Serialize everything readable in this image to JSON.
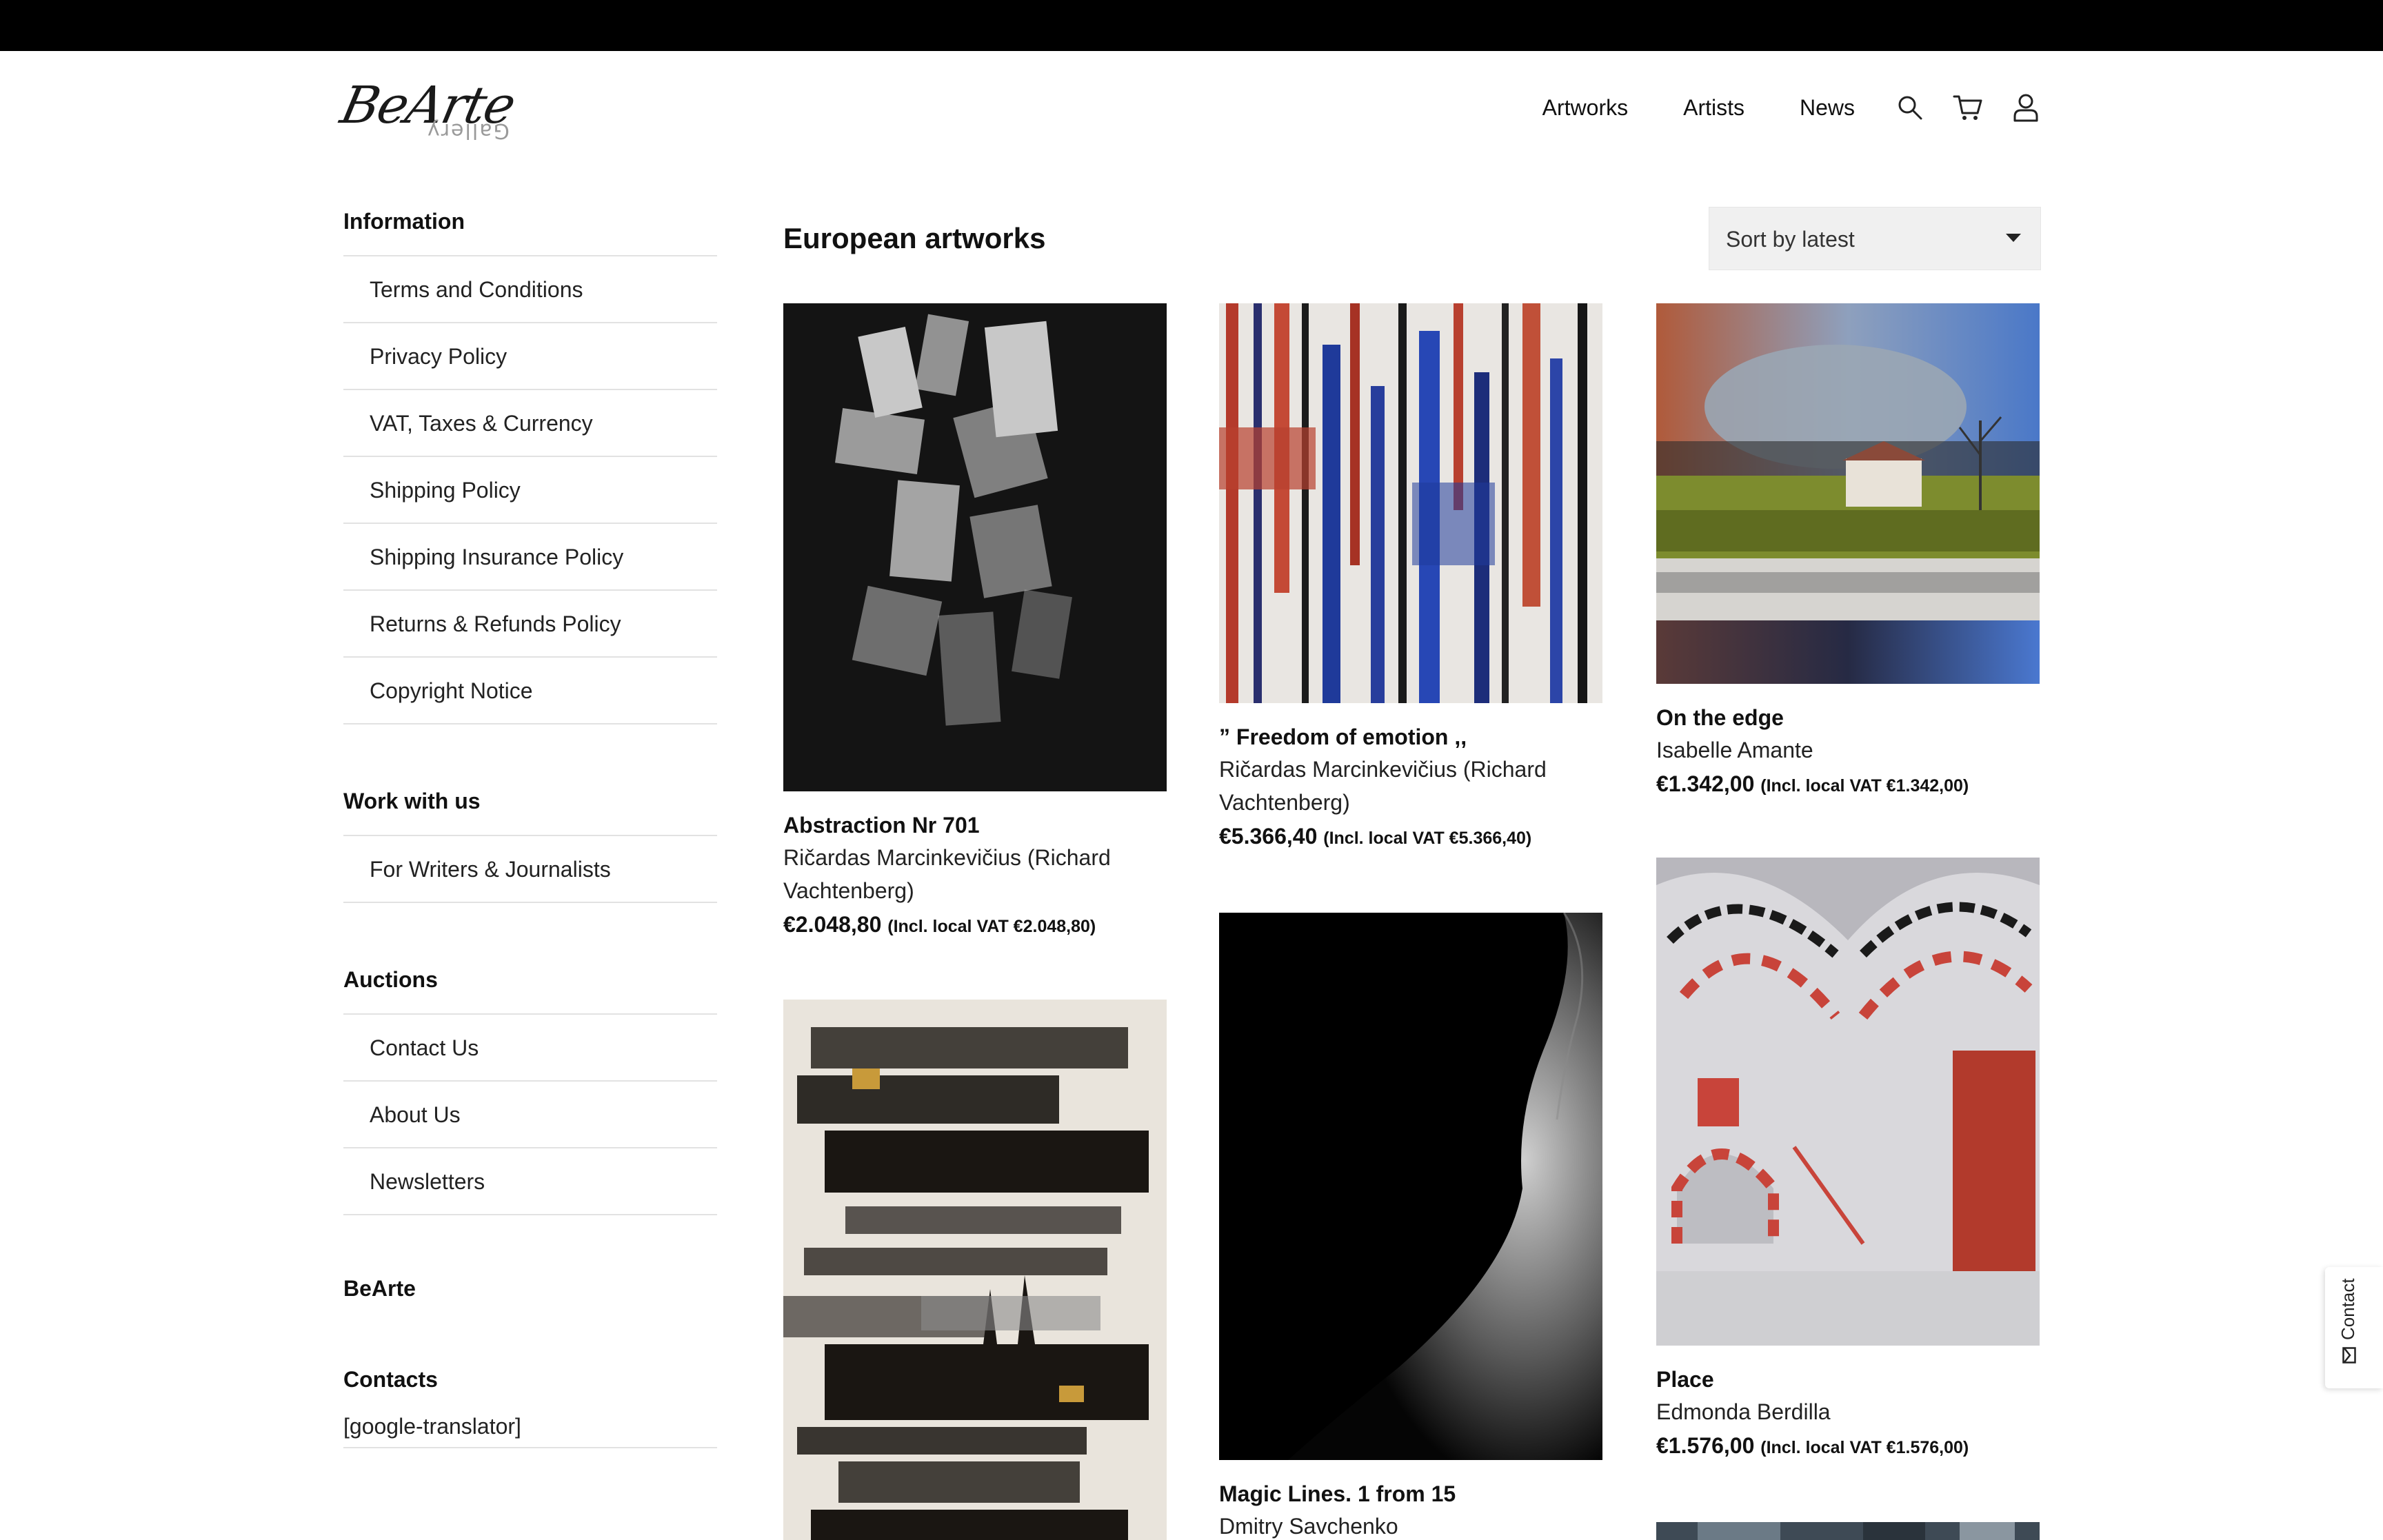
{
  "brand": {
    "logo_text": "BeArte",
    "logo_sub": "Gallery"
  },
  "nav": {
    "links": [
      "Artworks",
      "Artists",
      "News"
    ],
    "icons": [
      "search-icon",
      "cart-icon",
      "user-icon"
    ]
  },
  "sidebar": {
    "groups": [
      {
        "heading": "Information",
        "items": [
          "Terms and Conditions",
          "Privacy Policy",
          "VAT, Taxes & Currency",
          "Shipping Policy",
          "Shipping Insurance Policy",
          "Returns & Refunds Policy",
          "Copyright Notice"
        ]
      },
      {
        "heading": "Work with us",
        "items": [
          "For Writers & Journalists"
        ]
      },
      {
        "heading": "Auctions",
        "items": [
          "Contact Us",
          "About Us",
          "Newsletters"
        ]
      }
    ],
    "bearte_heading": "BeArte",
    "contacts_heading": "Contacts",
    "translator": "[google-translator]"
  },
  "main": {
    "title": "European artworks",
    "sort": {
      "selected": "Sort by latest"
    },
    "artworks": [
      {
        "title": "Abstraction Nr 701",
        "artist": "Ričardas Marcinkevičius (Richard Vachtenberg)",
        "price": "€2.048,80",
        "vat": "(Incl. local VAT €2.048,80)"
      },
      {
        "title": "” Freedom of emotion ,,",
        "artist": "Ričardas Marcinkevičius (Richard Vachtenberg)",
        "price": "€5.366,40",
        "vat": "(Incl. local VAT €5.366,40)"
      },
      {
        "title": "On the edge",
        "artist": "Isabelle Amante",
        "price": "€1.342,00",
        "vat": "(Incl. local VAT €1.342,00)"
      },
      {
        "title": "",
        "artist": "",
        "price": "",
        "vat": ""
      },
      {
        "title": "Magic Lines. 1 from 15",
        "artist": "Dmitry Savchenko",
        "price": "",
        "vat": ""
      },
      {
        "title": "Place",
        "artist": "Edmonda Berdilla",
        "price": "€1.576,00",
        "vat": "(Incl. local VAT €1.576,00)"
      }
    ]
  },
  "contact_tab": {
    "label": "Contact",
    "icon": "mail-icon"
  }
}
